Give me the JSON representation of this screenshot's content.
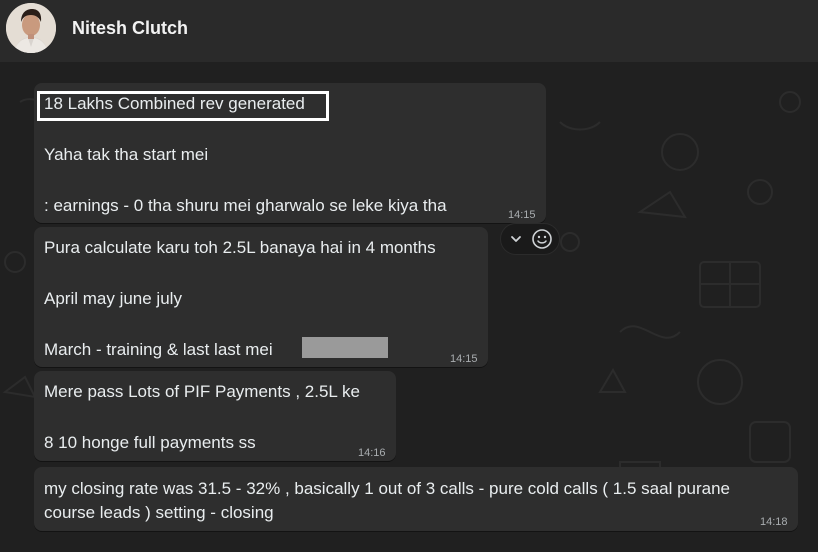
{
  "header": {
    "contact_name": "Nitesh Clutch"
  },
  "messages": [
    {
      "highlighted_line": "18 Lakhs Combined rev generated",
      "lines": [
        "Yaha tak tha start mei",
        ": earnings - 0 tha shuru mei gharwalo se leke kiya tha"
      ],
      "time": "14:15"
    },
    {
      "lines": [
        "Pura calculate karu toh 2.5L banaya hai in 4 months",
        "April may june july",
        "March - training & last last mei"
      ],
      "redacted": true,
      "time": "14:15"
    },
    {
      "lines": [
        "Mere pass Lots of PIF Payments , 2.5L ke",
        "8 10 honge full payments ss"
      ],
      "time": "14:16"
    },
    {
      "lines": [
        "my closing rate was 31.5 - 32% , basically 1 out of 3 calls - pure cold calls ( 1.5 saal purane",
        "course leads ) setting - closing"
      ],
      "time": "14:18"
    }
  ],
  "message_actions": {
    "icons": [
      "chevron-down-icon",
      "emoji-icon"
    ]
  },
  "colors": {
    "header_bg": "#2a2a2a",
    "chat_bg": "#202020",
    "bubble_bg": "#2e2e2e",
    "text": "#e9edef",
    "timestamp": "#a9adb0",
    "redaction": "#9a9a9a"
  }
}
